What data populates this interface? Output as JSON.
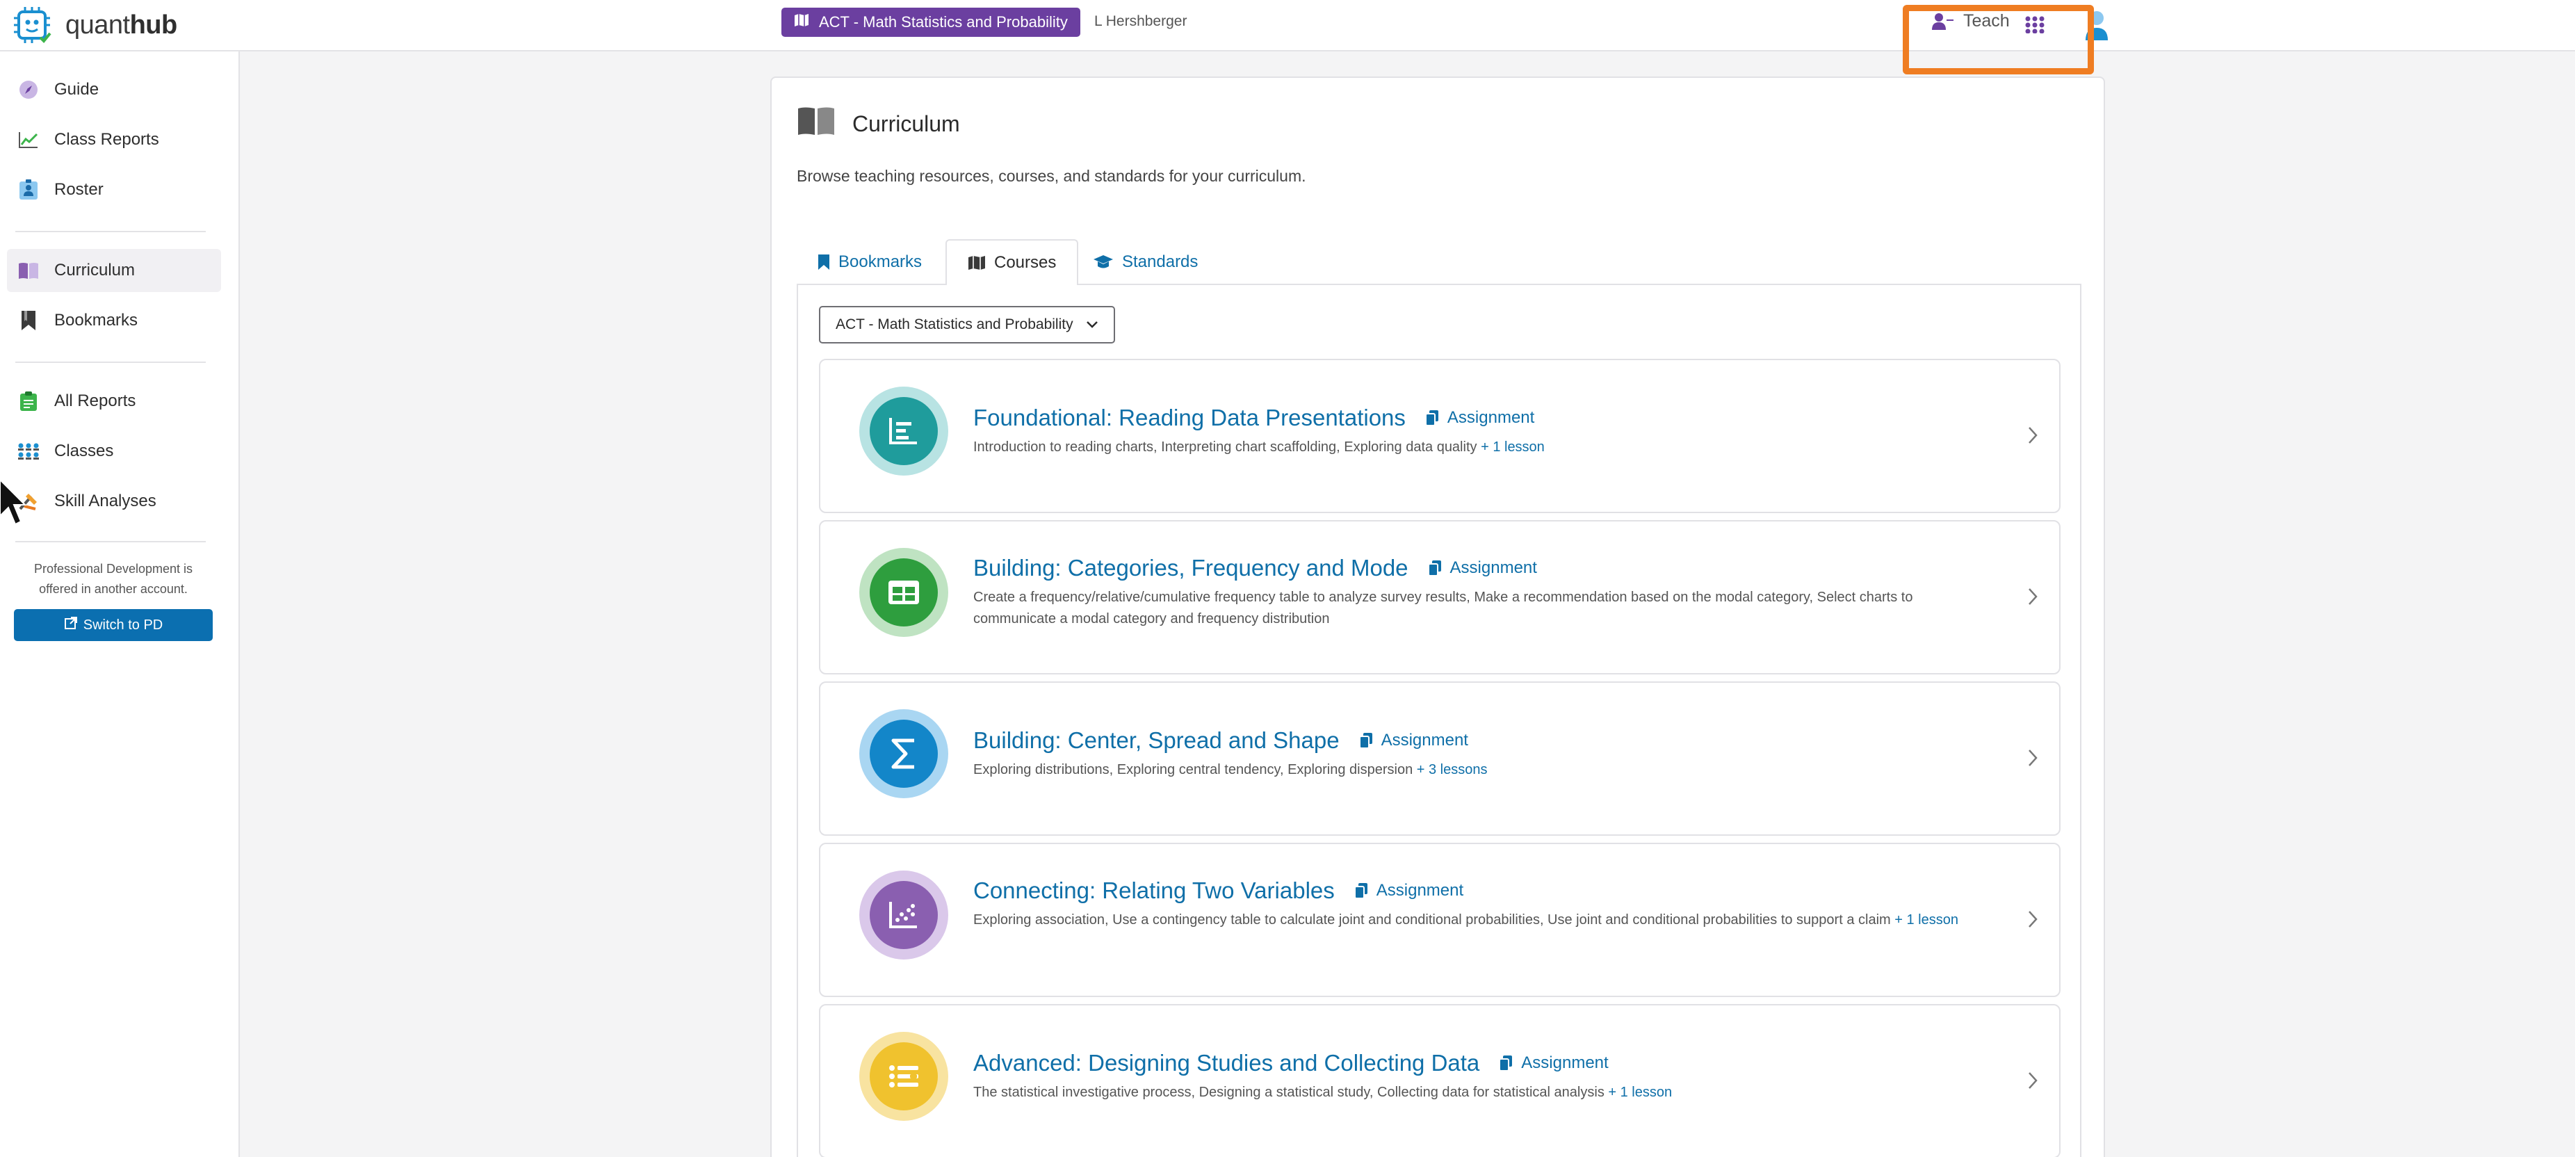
{
  "header": {
    "logo_light": "quant",
    "logo_bold": "hub",
    "course_pill": "ACT - Math Statistics and Probability",
    "user_name": "L Hershberger",
    "teach_label": "Teach"
  },
  "sidebar": {
    "items": [
      {
        "label": "Guide",
        "icon": "compass-icon"
      },
      {
        "label": "Class Reports",
        "icon": "line-chart-icon"
      },
      {
        "label": "Roster",
        "icon": "id-badge-icon"
      },
      {
        "label": "Curriculum",
        "icon": "book-icon"
      },
      {
        "label": "Bookmarks",
        "icon": "bookmark-icon"
      },
      {
        "label": "All Reports",
        "icon": "clipboard-icon"
      },
      {
        "label": "Classes",
        "icon": "people-group-icon"
      },
      {
        "label": "Skill Analyses",
        "icon": "tools-icon"
      }
    ],
    "pd_text": "Professional Development is offered in another account.",
    "pd_button": "Switch to PD"
  },
  "main": {
    "title": "Curriculum",
    "description": "Browse teaching resources, courses, and standards for your curriculum.",
    "tabs": [
      {
        "label": "Bookmarks"
      },
      {
        "label": "Courses",
        "active": true
      },
      {
        "label": "Standards"
      }
    ],
    "course_select": "ACT - Math Statistics and Probability",
    "assignment_label": "Assignment",
    "courses": [
      {
        "title": "Foundational: Reading Data Presentations",
        "description": "Introduction to reading charts, Interpreting chart scaffolding, Exploring data quality",
        "more": "+ 1 lesson",
        "color": "#1f9c9c"
      },
      {
        "title": "Building: Categories, Frequency and Mode",
        "description": "Create a frequency/relative/cumulative frequency table to analyze survey results, Make a recommendation based on the modal category, Select charts to communicate a modal category and frequency distribution",
        "more": "",
        "color": "#2e9e3e"
      },
      {
        "title": "Building: Center, Spread and Shape",
        "description": "Exploring distributions, Exploring central tendency, Exploring dispersion",
        "more": "+ 3 lessons",
        "color": "#1386c9"
      },
      {
        "title": "Connecting: Relating Two Variables",
        "description": "Exploring association, Use a contingency table to calculate joint and conditional probabilities, Use joint and conditional probabilities to support a claim",
        "more": "+ 1 lesson",
        "color": "#8a5fb0"
      },
      {
        "title": "Advanced: Designing Studies and Collecting Data",
        "description": "The statistical investigative process, Designing a statistical study, Collecting data for statistical analysis",
        "more": "+ 1 lesson",
        "color": "#f0c22e"
      }
    ]
  },
  "colors": {
    "accent_purple": "#6b3fa0",
    "link_blue": "#0f6fa8",
    "button_blue": "#0b6fb0",
    "highlight_orange": "#ef7d22"
  }
}
